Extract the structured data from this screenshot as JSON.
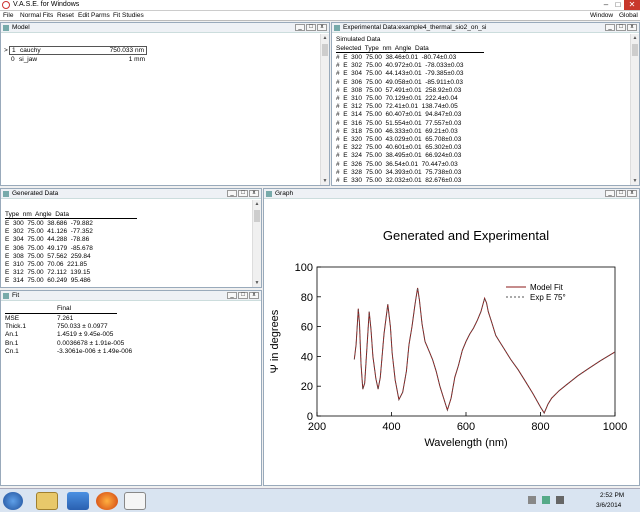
{
  "window": {
    "title": "V.A.S.E. for Windows",
    "right_menus": [
      "Window",
      "Global"
    ]
  },
  "menu": [
    "File",
    "Normal Fits",
    "Reset",
    "Edit Parms",
    "Fit Studies"
  ],
  "model": {
    "title": "Model",
    "layers": [
      {
        "marker": ">",
        "num": "1",
        "name": "cauchy",
        "value": "750.033 nm"
      },
      {
        "marker": "",
        "num": "0",
        "name": "si_jaw",
        "value": "1 mm"
      }
    ]
  },
  "experimental": {
    "title": "Experimental Data:example4_thermal_sio2_on_si",
    "subtitle": "Simulated Data",
    "header": "Selected  Type  nm  Angle  Data",
    "rows": [
      "#  E  300  75.00  38.46±0.01  -80.74±0.03",
      "#  E  302  75.00  40.972±0.01  -78.033±0.03",
      "#  E  304  75.00  44.143±0.01  -79.385±0.03",
      "#  E  306  75.00  49.058±0.01  -85.911±0.03",
      "#  E  308  75.00  57.491±0.01  258.92±0.03",
      "#  E  310  75.00  70.129±0.01  222.4±0.04",
      "#  E  312  75.00  72.41±0.01  138.74±0.05",
      "#  E  314  75.00  60.407±0.01  94.847±0.03",
      "#  E  316  75.00  51.554±0.01  77.557±0.03",
      "#  E  318  75.00  46.333±0.01  69.21±0.03",
      "#  E  320  75.00  43.029±0.01  65.708±0.03",
      "#  E  322  75.00  40.601±0.01  65.302±0.03",
      "#  E  324  75.00  38.495±0.01  66.924±0.03",
      "#  E  326  75.00  36.54±0.01  70.447±0.03",
      "#  E  328  75.00  34.393±0.01  75.738±0.03",
      "#  E  330  75.00  32.032±0.01  82.676±0.03"
    ]
  },
  "generated": {
    "title": "Generated Data",
    "header": "Type  nm  Angle  Data",
    "rows": [
      "E  300  75.00  38.686  -79.882",
      "E  302  75.00  41.126  -77.352",
      "E  304  75.00  44.288  -78.86",
      "E  306  75.00  49.179  -85.678",
      "E  308  75.00  57.562  259.84",
      "E  310  75.00  70.06  221.85",
      "E  312  75.00  72.112  139.15",
      "E  314  75.00  60.249  95.486"
    ]
  },
  "fit": {
    "title": "Fit",
    "col_header": "Final",
    "rows": [
      {
        "label": "MSE",
        "value": "7.261"
      },
      {
        "label": "Thick.1",
        "value": "750.033 ± 0.0977"
      },
      {
        "label": "An.1",
        "value": "1.4519 ± 9.45e-005"
      },
      {
        "label": "Bn.1",
        "value": "0.0036678 ± 1.91e-005"
      },
      {
        "label": "Cn.1",
        "value": "-3.3061e-006 ± 1.49e-006"
      }
    ]
  },
  "graph": {
    "title": "Graph"
  },
  "chart_data": {
    "type": "line",
    "title": "Generated and Experimental",
    "xlabel": "Wavelength (nm)",
    "ylabel": "Ψ in degrees",
    "xlim": [
      200,
      1000
    ],
    "ylim": [
      0,
      100
    ],
    "xticks": [
      200,
      400,
      600,
      800,
      1000
    ],
    "yticks": [
      0,
      20,
      40,
      60,
      80,
      100
    ],
    "legend": "right",
    "series": [
      {
        "name": "Model Fit",
        "color": "#8b1a1a",
        "x": [
          300,
          305,
          311,
          314,
          318,
          323,
          328,
          340,
          345,
          350,
          358,
          364,
          370,
          380,
          390,
          397,
          402,
          410,
          420,
          430,
          440,
          447,
          455,
          463,
          470,
          475,
          482,
          490,
          500,
          510,
          520,
          530,
          540,
          545,
          550,
          560,
          570,
          580,
          590,
          600,
          610,
          620,
          630,
          640,
          650,
          655,
          660,
          670,
          680,
          690,
          700,
          720,
          740,
          760,
          780,
          800,
          810,
          815,
          820,
          830,
          850,
          870,
          900,
          930,
          960,
          1000
        ],
        "y": [
          38,
          48,
          72,
          62,
          35,
          18,
          22,
          70,
          58,
          40,
          25,
          18,
          26,
          55,
          75,
          60,
          42,
          24,
          11,
          16,
          30,
          48,
          60,
          75,
          86,
          78,
          62,
          50,
          44,
          38,
          30,
          20,
          12,
          8,
          4,
          12,
          26,
          34,
          44,
          50,
          55,
          59,
          64,
          70,
          79,
          76,
          70,
          62,
          54,
          50,
          46,
          38,
          31,
          23,
          15,
          6,
          2,
          5,
          8,
          12,
          17,
          21,
          27,
          32,
          37,
          43
        ]
      },
      {
        "name": "Exp E 75°",
        "color": "#555555",
        "x": [
          300,
          305,
          311,
          314,
          318,
          323,
          328,
          340,
          345,
          350,
          358,
          364,
          370,
          380,
          390,
          397,
          402,
          410,
          420,
          430,
          440,
          447,
          455,
          463,
          470,
          475,
          482,
          490,
          500,
          510,
          520,
          530,
          540,
          545,
          550,
          560,
          570,
          580,
          590,
          600,
          610,
          620,
          630,
          640,
          650,
          655,
          660,
          670,
          680,
          690,
          700,
          720,
          740,
          760,
          780,
          800,
          810,
          815,
          820,
          830,
          850,
          870,
          900,
          930,
          960,
          1000
        ],
        "y": [
          38,
          48,
          72,
          62,
          35,
          18,
          22,
          70,
          58,
          40,
          25,
          18,
          26,
          55,
          75,
          60,
          42,
          24,
          11,
          16,
          30,
          48,
          60,
          75,
          86,
          78,
          62,
          50,
          44,
          38,
          30,
          20,
          12,
          8,
          4,
          12,
          26,
          34,
          44,
          50,
          55,
          59,
          64,
          70,
          79,
          76,
          70,
          62,
          54,
          50,
          46,
          38,
          31,
          23,
          15,
          6,
          2,
          5,
          8,
          12,
          17,
          21,
          27,
          32,
          37,
          43
        ]
      }
    ]
  },
  "tray": {
    "time": "2:52 PM",
    "date": "3/6/2014"
  }
}
